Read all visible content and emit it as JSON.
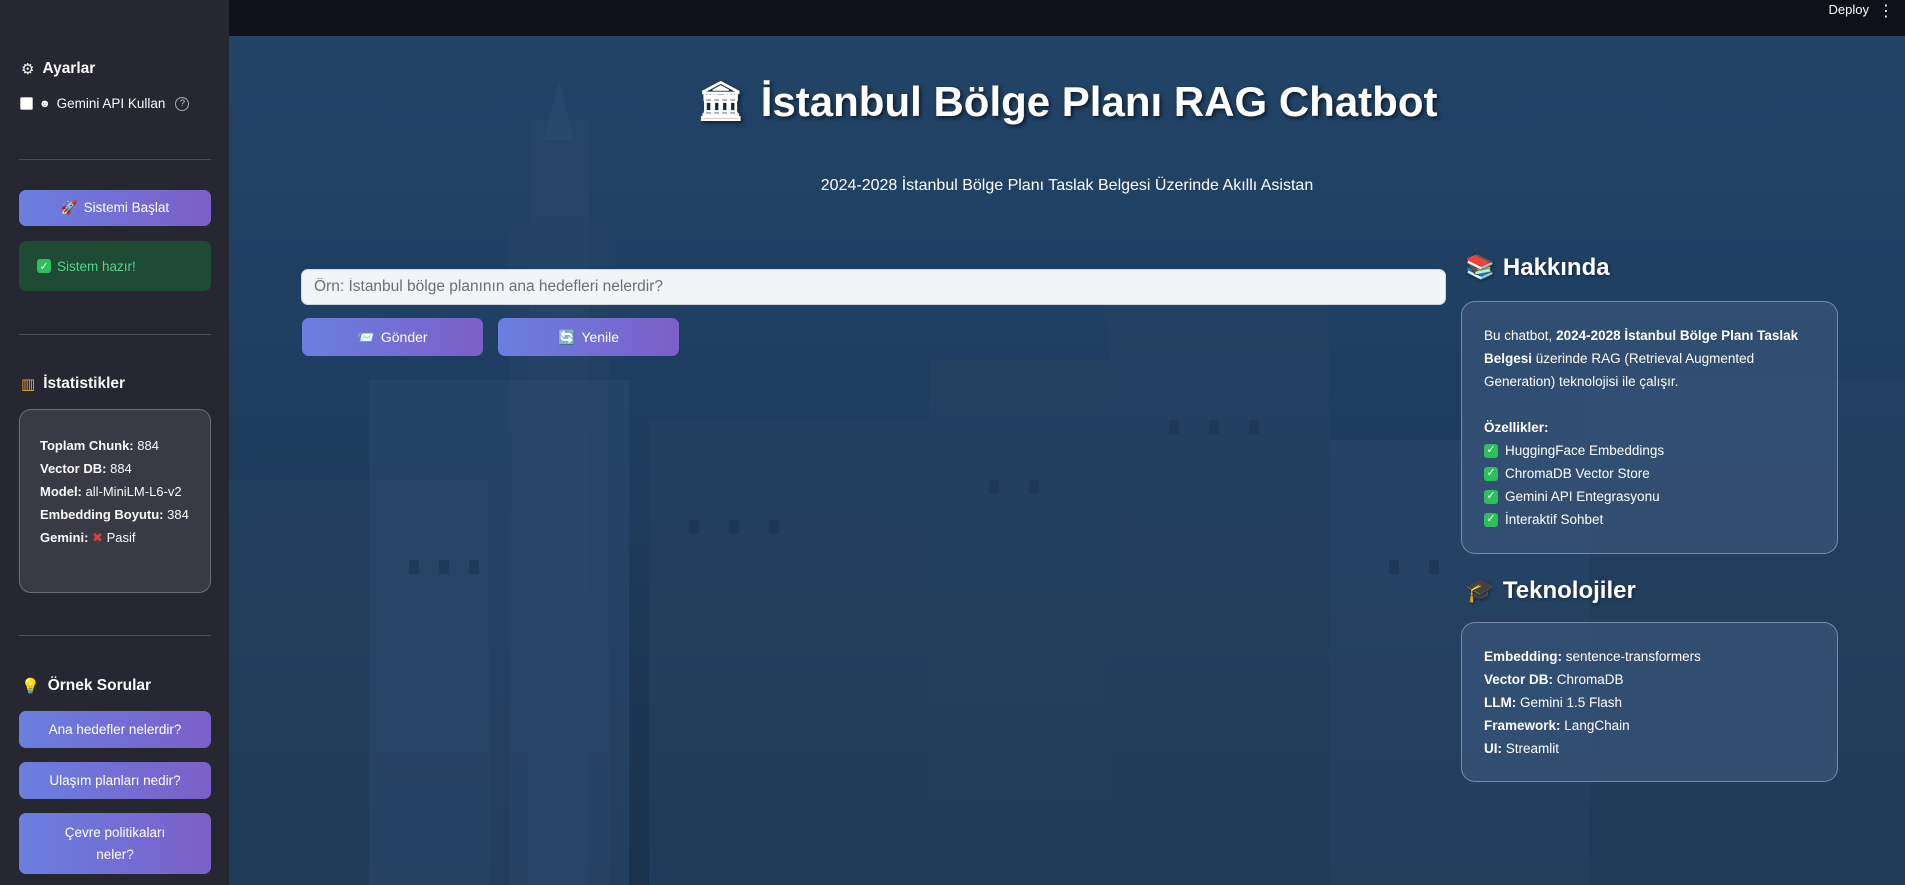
{
  "topbar": {
    "deploy_label": "Deploy",
    "menu_icon": "kebab-menu-icon"
  },
  "sidebar": {
    "settings_title": "Ayarlar",
    "gemini_checkbox_label": "Gemini API Kullan",
    "start_button": "Sistemi Başlat",
    "status_text": "Sistem hazır!",
    "stats_title": "İstatistikler",
    "stats": {
      "chunk_label": "Toplam Chunk:",
      "chunk_value": "884",
      "vdb_label": "Vector DB:",
      "vdb_value": "884",
      "model_label": "Model:",
      "model_value": "all-MiniLM-L6-v2",
      "emb_label": "Embedding Boyutu:",
      "emb_value": "384",
      "gemini_label": "Gemini:",
      "gemini_value": "Pasif"
    },
    "examples_title": "Örnek Sorular",
    "examples": [
      "Ana hedefler nelerdir?",
      "Ulaşım planları nedir?",
      "Çevre politikaları neler?"
    ]
  },
  "main": {
    "title": "İstanbul Bölge Planı RAG Chatbot",
    "subtitle": "2024-2028 İstanbul Bölge Planı Taslak Belgesi Üzerinde Akıllı Asistan",
    "query_placeholder": "Örn: İstanbul bölge planının ana hedefleri nelerdir?",
    "send_button": "Gönder",
    "refresh_button": "Yenile"
  },
  "about": {
    "title": "Hakkında",
    "intro_prefix": "Bu chatbot, ",
    "intro_bold": "2024-2028 İstanbul Bölge Planı Taslak Belgesi",
    "intro_suffix": " üzerinde RAG (Retrieval Augmented Generation) teknolojisi ile çalışır.",
    "features_title": "Özellikler:",
    "features": [
      "HuggingFace Embeddings",
      "ChromaDB Vector Store",
      "Gemini API Entegrasyonu",
      "İnteraktif Sohbet"
    ]
  },
  "tech": {
    "title": "Teknolojiler",
    "items": [
      {
        "label": "Embedding:",
        "value": "sentence-transformers"
      },
      {
        "label": "Vector DB:",
        "value": "ChromaDB"
      },
      {
        "label": "LLM:",
        "value": "Gemini 1.5 Flash"
      },
      {
        "label": "Framework:",
        "value": "LangChain"
      },
      {
        "label": "UI:",
        "value": "Streamlit"
      }
    ]
  },
  "colors": {
    "accent_start": "#6a7fe0",
    "accent_end": "#7b5fc8",
    "success": "#4fd58a",
    "sidebar_bg": "#262730",
    "topbar_bg": "#0e1117"
  }
}
